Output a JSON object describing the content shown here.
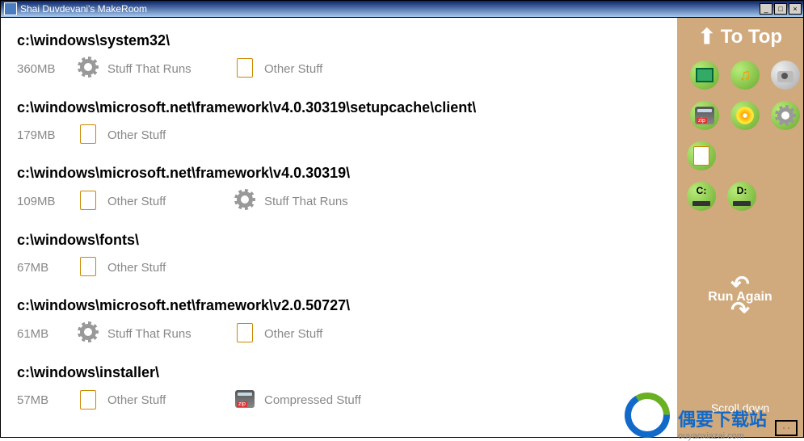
{
  "window": {
    "title": "Shai Duvdevani's MakeRoom"
  },
  "sidebar": {
    "to_top": "To Top",
    "drives": [
      {
        "label": "C:"
      },
      {
        "label": "D:"
      }
    ],
    "run_again": "Run Again",
    "scroll_hint": "Scroll down"
  },
  "entries": [
    {
      "path": "c:\\windows\\system32\\",
      "size": "360MB",
      "cats": [
        {
          "icon": "gear",
          "label": "Stuff That Runs"
        },
        {
          "icon": "doc",
          "label": "Other Stuff"
        }
      ]
    },
    {
      "path": "c:\\windows\\microsoft.net\\framework\\v4.0.30319\\setupcache\\client\\",
      "size": "179MB",
      "cats": [
        {
          "icon": "doc",
          "label": "Other Stuff"
        }
      ]
    },
    {
      "path": "c:\\windows\\microsoft.net\\framework\\v4.0.30319\\",
      "size": "109MB",
      "cats": [
        {
          "icon": "doc",
          "label": "Other Stuff"
        },
        {
          "icon": "gear",
          "label": "Stuff That Runs"
        }
      ]
    },
    {
      "path": "c:\\windows\\fonts\\",
      "size": "67MB",
      "cats": [
        {
          "icon": "doc",
          "label": "Other Stuff"
        }
      ]
    },
    {
      "path": "c:\\windows\\microsoft.net\\framework\\v2.0.50727\\",
      "size": "61MB",
      "cats": [
        {
          "icon": "gear",
          "label": "Stuff That Runs"
        },
        {
          "icon": "doc",
          "label": "Other Stuff"
        }
      ]
    },
    {
      "path": "c:\\windows\\installer\\",
      "size": "57MB",
      "cats": [
        {
          "icon": "doc",
          "label": "Other Stuff"
        },
        {
          "icon": "zip",
          "label": "Compressed Stuff"
        }
      ]
    }
  ],
  "watermark": {
    "main": "偶要下载站",
    "sub": "ouyaoxiazai.com"
  }
}
